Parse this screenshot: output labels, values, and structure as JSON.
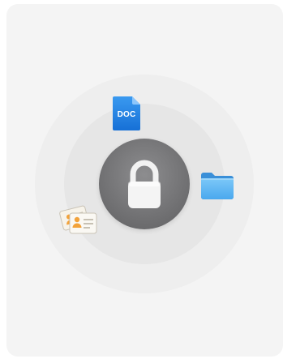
{
  "icons": {
    "center": "lock-icon",
    "top": "doc-file-icon",
    "right": "folder-icon",
    "left": "contact-cards-icon"
  },
  "doc": {
    "label": "DOC"
  },
  "colors": {
    "card_bg": "#f4f4f4",
    "ring_outer": "#eeeeee",
    "ring_inner": "#e6e6e6",
    "lock_disc": "#6f6f71",
    "doc_blue": "#1e7fe0",
    "folder_blue": "#5ab4f2",
    "contact_orange": "#f2a23a"
  }
}
